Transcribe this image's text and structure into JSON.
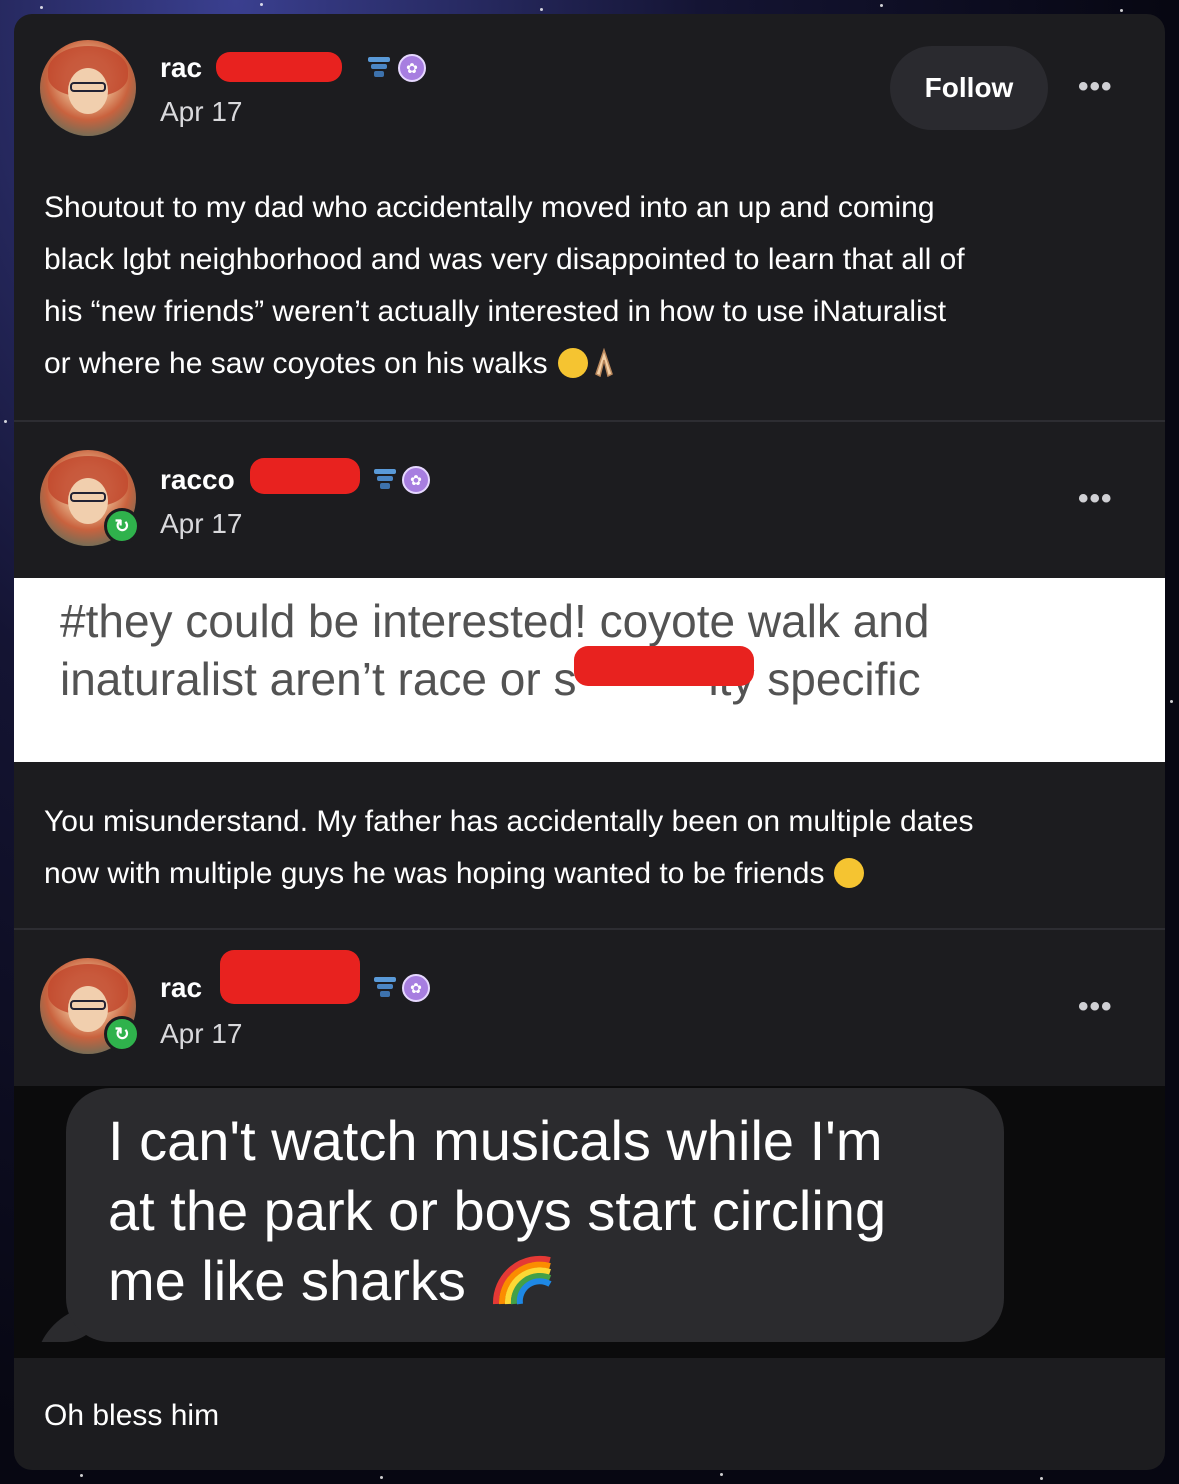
{
  "posts": [
    {
      "username": "rac",
      "date": "Apr 17",
      "follow_label": "Follow",
      "text_lines": [
        "Shoutout to my dad who accidentally moved into an up and coming",
        "black lgbt neighborhood and was very disappointed to learn that all of",
        "his “new friends” weren’t actually interested in how to use iNaturalist",
        "or where he saw coyotes on his walks"
      ]
    },
    {
      "username": "racco",
      "date": "Apr 17",
      "quote_lines": [
        "#they could be interested! coyote walk and",
        "inaturalist aren’t race or s",
        "ity specific"
      ],
      "text_lines": [
        "You misunderstand. My father has accidentally been on multiple dates",
        "now with multiple guys he was hoping wanted to be friends"
      ]
    },
    {
      "username": "rac",
      "date": "Apr 17",
      "bubble_lines": [
        "I can't watch musicals while I'm",
        "at the park or boys start circling",
        "me like sharks"
      ],
      "text": "Oh bless him"
    }
  ],
  "icons": {
    "more": "more-horizontal-icon",
    "reblog": "reblog-icon",
    "badge_blue": "blue-badge-icon",
    "badge_purple": "purple-paw-badge-icon"
  },
  "colors": {
    "card_bg": "#1c1c1f",
    "redaction": "#e8221f",
    "reblog_green": "#2fb24c",
    "quote_bg": "#ffffff",
    "bubble_bg": "#2b2b2e"
  }
}
